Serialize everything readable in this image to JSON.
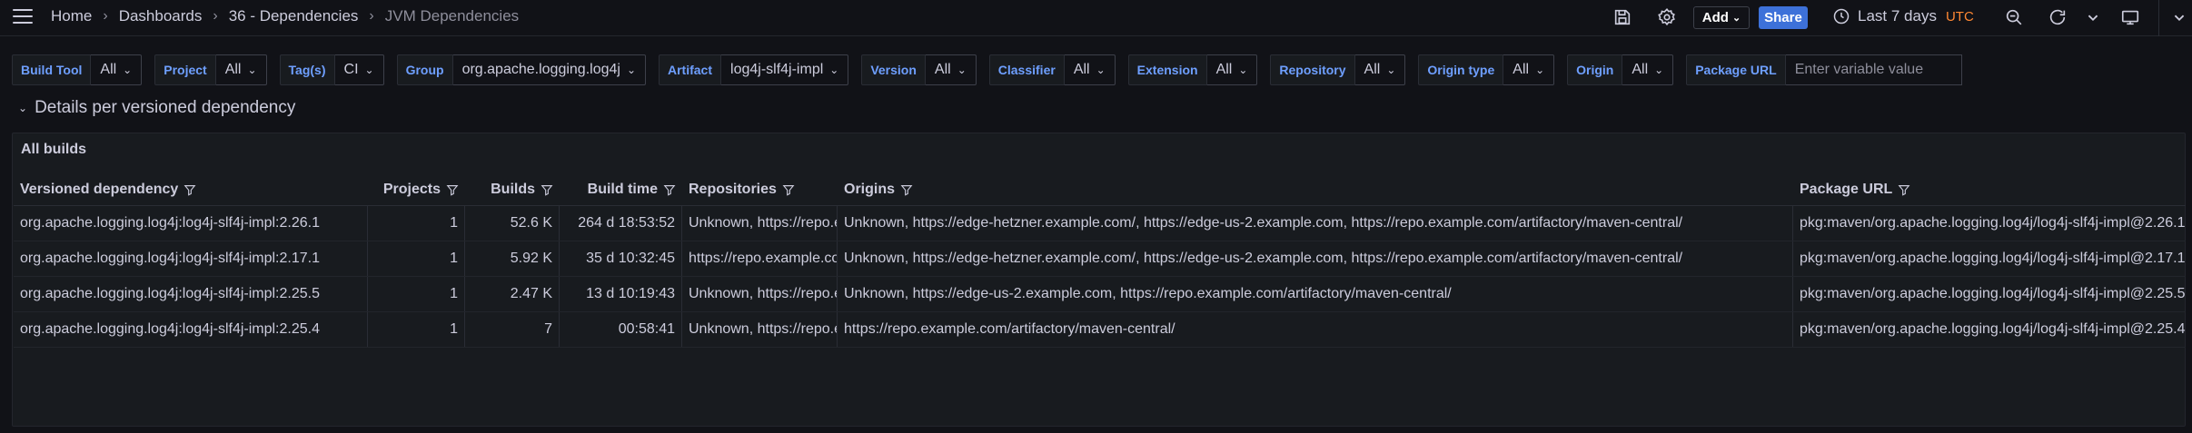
{
  "nav": {
    "breadcrumbs": [
      "Home",
      "Dashboards",
      "36 - Dependencies",
      "JVM Dependencies"
    ],
    "add_label": "Add",
    "share_label": "Share",
    "time_range": "Last 7 days",
    "timezone": "UTC"
  },
  "variables": [
    {
      "label": "Build Tool",
      "value": "All"
    },
    {
      "label": "Project",
      "value": "All"
    },
    {
      "label": "Tag(s)",
      "value": "CI"
    },
    {
      "label": "Group",
      "value": "org.apache.logging.log4j"
    },
    {
      "label": "Artifact",
      "value": "log4j-slf4j-impl"
    },
    {
      "label": "Version",
      "value": "All"
    },
    {
      "label": "Classifier",
      "value": "All"
    },
    {
      "label": "Extension",
      "value": "All"
    },
    {
      "label": "Repository",
      "value": "All"
    },
    {
      "label": "Origin type",
      "value": "All"
    },
    {
      "label": "Origin",
      "value": "All"
    }
  ],
  "package_url_var": {
    "label": "Package URL",
    "placeholder": "Enter variable value"
  },
  "row": {
    "title": "Details per versioned dependency"
  },
  "panel": {
    "title": "All builds",
    "columns": [
      "Versioned dependency",
      "Projects",
      "Builds",
      "Build time",
      "Repositories",
      "Origins",
      "Package URL"
    ],
    "rows": [
      [
        "org.apache.logging.log4j:log4j-slf4j-impl:2.26.1",
        "1",
        "52.6 K",
        "264 d 18:53:52",
        "Unknown, https://repo.example.com/artifactory/maven-central/",
        "Unknown, https://edge-hetzner.example.com/, https://edge-us-2.example.com, https://repo.example.com/artifactory/maven-central/",
        "pkg:maven/org.apache.logging.log4j/log4j-slf4j-impl@2.26.1"
      ],
      [
        "org.apache.logging.log4j:log4j-slf4j-impl:2.17.1",
        "1",
        "5.92 K",
        "35 d 10:32:45",
        "https://repo.example.com/artifactory/maven-central/",
        "Unknown, https://edge-hetzner.example.com/, https://edge-us-2.example.com, https://repo.example.com/artifactory/maven-central/",
        "pkg:maven/org.apache.logging.log4j/log4j-slf4j-impl@2.17.1"
      ],
      [
        "org.apache.logging.log4j:log4j-slf4j-impl:2.25.5",
        "1",
        "2.47 K",
        "13 d 10:19:43",
        "Unknown, https://repo.example.com/artifactory/maven-central/",
        "Unknown, https://edge-us-2.example.com, https://repo.example.com/artifactory/maven-central/",
        "pkg:maven/org.apache.logging.log4j/log4j-slf4j-impl@2.25.5"
      ],
      [
        "org.apache.logging.log4j:log4j-slf4j-impl:2.25.4",
        "1",
        "7",
        "00:58:41",
        "Unknown, https://repo.example.com/artifactory/maven-central/",
        "https://repo.example.com/artifactory/maven-central/",
        "pkg:maven/org.apache.logging.log4j/log4j-slf4j-impl@2.25.4"
      ]
    ]
  },
  "colors": {
    "accent": "#3d71d9",
    "utc": "#ff8833",
    "var_label": "#6e9fff"
  }
}
